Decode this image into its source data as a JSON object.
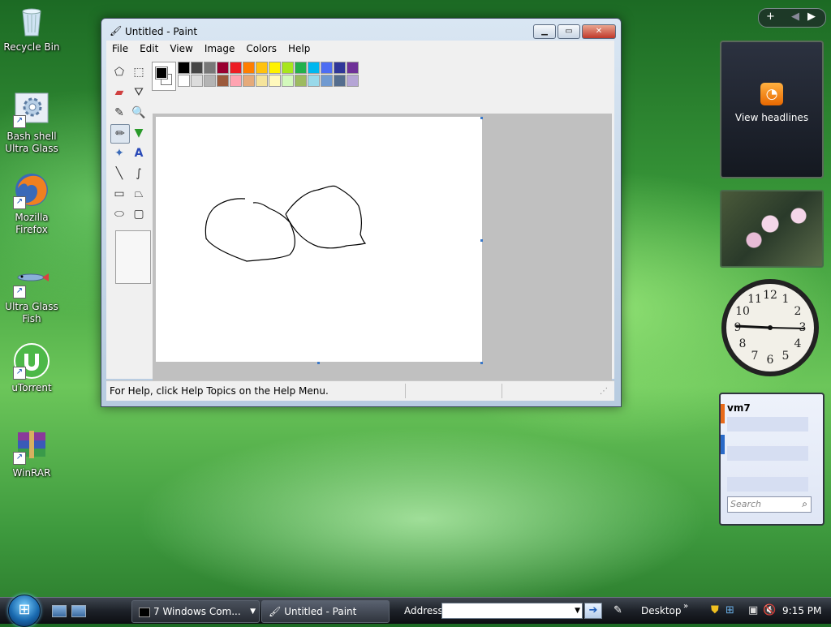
{
  "desktop": {
    "icons": [
      {
        "label": "Recycle Bin"
      },
      {
        "label": "Bash shell\nUltra Glass"
      },
      {
        "label": "Mozilla\nFirefox"
      },
      {
        "label": "Ultra Glass\nFish"
      },
      {
        "label": "uTorrent"
      },
      {
        "label": "WinRAR"
      }
    ]
  },
  "paint": {
    "title": "Untitled - Paint",
    "menu": [
      "File",
      "Edit",
      "View",
      "Image",
      "Colors",
      "Help"
    ],
    "status": "For Help, click Help Topics on the Help Menu.",
    "palette_top": [
      "#000000",
      "#464646",
      "#787878",
      "#990030",
      "#ed1c24",
      "#ff7e00",
      "#ffc20e",
      "#fff200",
      "#a8e61d",
      "#22b14c",
      "#00b7ef",
      "#4d6df3",
      "#2f3699",
      "#6f3198"
    ],
    "palette_bottom": [
      "#ffffff",
      "#dcdcdc",
      "#b4b4b4",
      "#9c5a3c",
      "#ffa3b1",
      "#e5aa7a",
      "#f5e49c",
      "#fff9bd",
      "#d3f9bc",
      "#9dbb61",
      "#99d9ea",
      "#709ad1",
      "#546d8e",
      "#b5a5d5"
    ]
  },
  "sidebar": {
    "feeds_label": "View headlines",
    "contacts_title": "vm7",
    "search_placeholder": "Search"
  },
  "taskbar": {
    "start_label": "Start",
    "tasks": [
      {
        "label": "7 Windows Com...",
        "icon": "command-prompt-icon"
      },
      {
        "label": "Untitled - Paint",
        "icon": "paint-icon"
      }
    ],
    "address_label": "Address",
    "address_value": "",
    "desktop_label": "Desktop",
    "clock": "9:15 PM"
  }
}
